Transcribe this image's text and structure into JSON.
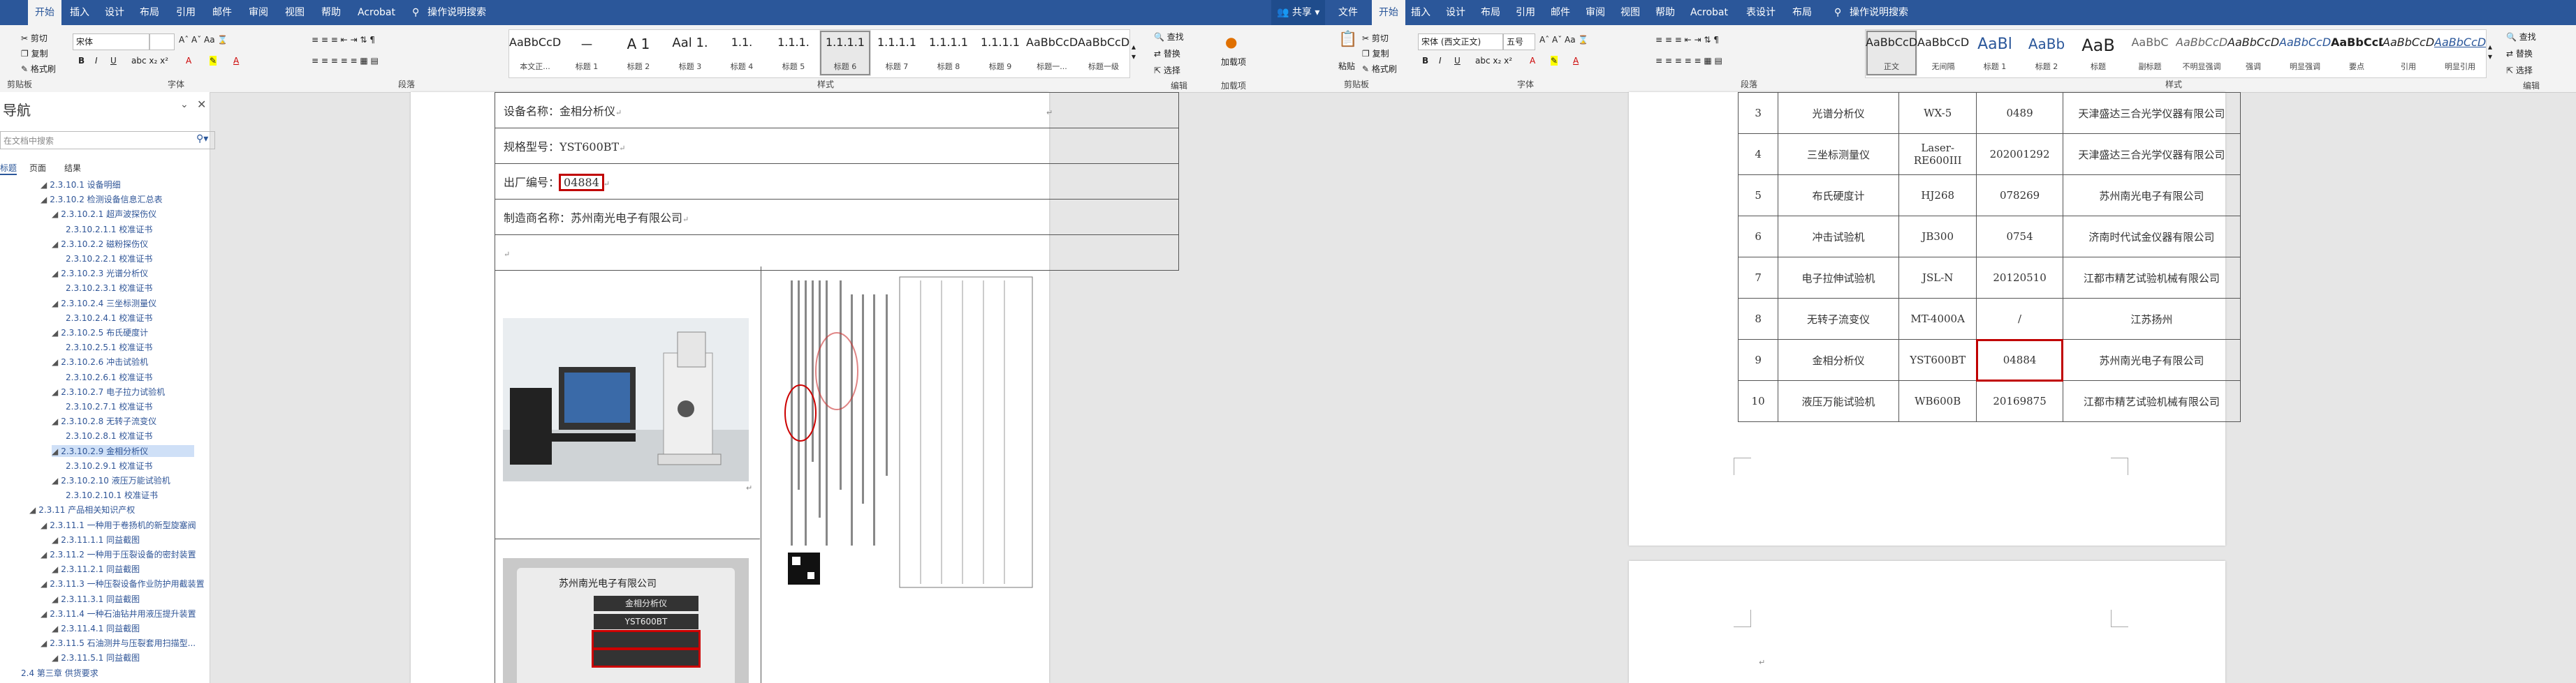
{
  "left": {
    "tabs": [
      "开始",
      "插入",
      "设计",
      "布局",
      "引用",
      "邮件",
      "审阅",
      "视图",
      "帮助",
      "Acrobat",
      "操作说明搜索"
    ],
    "active_tab": "开始",
    "clipboard": {
      "cut": "剪切",
      "copy": "复制",
      "format_painter": "格式刷",
      "label": "剪贴板"
    },
    "font": {
      "name": "宋体",
      "size": "",
      "label": "字体"
    },
    "paragraph_label": "段落",
    "styles_label": "样式",
    "styles": [
      {
        "sample": "AaBbCcDd",
        "name": "本文正..."
      },
      {
        "sample": "一",
        "name": "标题 1"
      },
      {
        "sample": "A 1",
        "name": "标题 2"
      },
      {
        "sample": "Aal 1.",
        "name": "标题 3"
      },
      {
        "sample": "1.1.",
        "name": "标题 4"
      },
      {
        "sample": "1.1.1.",
        "name": "标题 5"
      },
      {
        "sample": "1.1.1.1",
        "name": "标题 6"
      },
      {
        "sample": "1.1.1.1",
        "name": "标题 7"
      },
      {
        "sample": "1.1.1.1",
        "name": "标题 8"
      },
      {
        "sample": "1.1.1.1",
        "name": "标题 9"
      },
      {
        "sample": "AaBbCcDd",
        "name": "标题一..."
      },
      {
        "sample": "AaBbCcDc",
        "name": "标题一级"
      }
    ],
    "editing": {
      "find": "查找",
      "replace": "替换",
      "select": "选择",
      "label": "编辑"
    },
    "addin": {
      "name": "加载项",
      "label": "加载项"
    },
    "nav": {
      "title": "导航",
      "search_placeholder": "在文档中搜索",
      "tabs": [
        "标题",
        "页面",
        "结果"
      ],
      "items": [
        {
          "text": "2.3.10.1 设备明细",
          "level": 3
        },
        {
          "text": "2.3.10.2 检测设备信息汇总表",
          "level": 3
        },
        {
          "text": "2.3.10.2.1 超声波探伤仪",
          "level": 4
        },
        {
          "text": "2.3.10.2.1.1 校准证书",
          "level": 5
        },
        {
          "text": "2.3.10.2.2 磁粉探伤仪",
          "level": 4
        },
        {
          "text": "2.3.10.2.2.1 校准证书",
          "level": 5
        },
        {
          "text": "2.3.10.2.3 光谱分析仪",
          "level": 4
        },
        {
          "text": "2.3.10.2.3.1 校准证书",
          "level": 5
        },
        {
          "text": "2.3.10.2.4 三坐标测量仪",
          "level": 4
        },
        {
          "text": "2.3.10.2.4.1 校准证书",
          "level": 5
        },
        {
          "text": "2.3.10.2.5 布氏硬度计",
          "level": 4
        },
        {
          "text": "2.3.10.2.5.1 校准证书",
          "level": 5
        },
        {
          "text": "2.3.10.2.6 冲击试验机",
          "level": 4
        },
        {
          "text": "2.3.10.2.6.1 校准证书",
          "level": 5
        },
        {
          "text": "2.3.10.2.7 电子拉力试验机",
          "level": 4
        },
        {
          "text": "2.3.10.2.7.1 校准证书",
          "level": 5
        },
        {
          "text": "2.3.10.2.8 无转子流变仪",
          "level": 4
        },
        {
          "text": "2.3.10.2.8.1 校准证书",
          "level": 5
        },
        {
          "text": "2.3.10.2.9 金相分析仪",
          "level": 4
        },
        {
          "text": "2.3.10.2.9.1 校准证书",
          "level": 5
        },
        {
          "text": "2.3.10.2.10 液压万能试验机",
          "level": 4
        },
        {
          "text": "2.3.10.2.10.1 校准证书",
          "level": 5
        },
        {
          "text": "2.3.11 产品相关知识产权",
          "level": 2
        },
        {
          "text": "2.3.11.1 一种用于卷扬机的新型旋塞阀",
          "level": 3
        },
        {
          "text": "2.3.11.1.1 同益截图",
          "level": 4
        },
        {
          "text": "2.3.11.2 一种用于压裂设备的密封装置",
          "level": 3
        },
        {
          "text": "2.3.11.2.1 同益截图",
          "level": 4
        },
        {
          "text": "2.3.11.3 一种压裂设备作业防护用截装置",
          "level": 3
        },
        {
          "text": "2.3.11.3.1 同益截图",
          "level": 4
        },
        {
          "text": "2.3.11.4 一种石油钻井用液压提升装置",
          "level": 3
        },
        {
          "text": "2.3.11.4.1 同益截图",
          "level": 4
        },
        {
          "text": "2.3.11.5 石油测井与压裂套用扫描型...",
          "level": 3
        },
        {
          "text": "2.3.11.5.1 同益截图",
          "level": 4
        },
        {
          "text": "2.4 第三章 供货要求",
          "level": 1
        }
      ]
    },
    "spec_rows": [
      {
        "label": "设备名称：",
        "value": "金相分析仪"
      },
      {
        "label": "规格型号：",
        "value": "YST600BT"
      },
      {
        "label": "出厂编号：",
        "value": "04884"
      },
      {
        "label": "制造商名称：",
        "value": "苏州南光电子有限公司"
      }
    ],
    "nameplate": {
      "company": "苏州南光电子有限公司",
      "product": "金相分析仪",
      "model": "YST600BT"
    }
  },
  "right": {
    "share": "共享",
    "tabs": [
      "文件",
      "开始",
      "插入",
      "设计",
      "布局",
      "引用",
      "邮件",
      "审阅",
      "视图",
      "帮助",
      "Acrobat",
      "表设计",
      "布局",
      "操作说明搜索"
    ],
    "active_tab": "开始",
    "clipboard": {
      "cut": "剪切",
      "copy": "复制",
      "format_painter": "格式刷",
      "paste": "粘贴",
      "label": "剪贴板"
    },
    "font": {
      "name": "宋体 (西文正文)",
      "size": "五号",
      "label": "字体"
    },
    "paragraph_label": "段落",
    "styles_label": "样式",
    "styles": [
      {
        "sample": "AaBbCcDi",
        "name": "正文"
      },
      {
        "sample": "AaBbCcDi",
        "name": "无间隔"
      },
      {
        "sample": "AaBl",
        "name": "标题 1"
      },
      {
        "sample": "AaBb",
        "name": "标题 2"
      },
      {
        "sample": "AaB",
        "name": "标题"
      },
      {
        "sample": "AaBbC",
        "name": "副标题"
      },
      {
        "sample": "AaBbCcDi",
        "name": "不明显强调"
      },
      {
        "sample": "AaBbCcDi",
        "name": "强调"
      },
      {
        "sample": "AaBbCcDi",
        "name": "明显强调"
      },
      {
        "sample": "AaBbCcD",
        "name": "要点"
      },
      {
        "sample": "AaBbCcDi",
        "name": "引用"
      },
      {
        "sample": "AaBbCcDi",
        "name": "明显引用"
      }
    ],
    "editing": {
      "find": "查找",
      "replace": "替换",
      "select": "选择",
      "label": "编辑"
    },
    "table_rows": [
      {
        "no": "3",
        "name": "光谱分析仪",
        "model": "WX-5",
        "serial": "0489",
        "maker": "天津盛达三合光学仪器有限公司"
      },
      {
        "no": "4",
        "name": "三坐标测量仪",
        "model": "Laser-RE600III",
        "serial": "202001292",
        "maker": "天津盛达三合光学仪器有限公司"
      },
      {
        "no": "5",
        "name": "布氏硬度计",
        "model": "HJ268",
        "serial": "078269",
        "maker": "苏州南光电子有限公司"
      },
      {
        "no": "6",
        "name": "冲击试验机",
        "model": "JB300",
        "serial": "0754",
        "maker": "济南时代试金仪器有限公司"
      },
      {
        "no": "7",
        "name": "电子拉伸试验机",
        "model": "JSL-N",
        "serial": "20120510",
        "maker": "江都市精艺试验机械有限公司"
      },
      {
        "no": "8",
        "name": "无转子流变仪",
        "model": "MT-4000A",
        "serial": "/",
        "maker": "江苏扬州"
      },
      {
        "no": "9",
        "name": "金相分析仪",
        "model": "YST600BT",
        "serial": "04884",
        "maker": "苏州南光电子有限公司"
      },
      {
        "no": "10",
        "name": "液压万能试验机",
        "model": "WB600B",
        "serial": "20169875",
        "maker": "江都市精艺试验机械有限公司"
      }
    ],
    "highlight_serial": "04884"
  }
}
